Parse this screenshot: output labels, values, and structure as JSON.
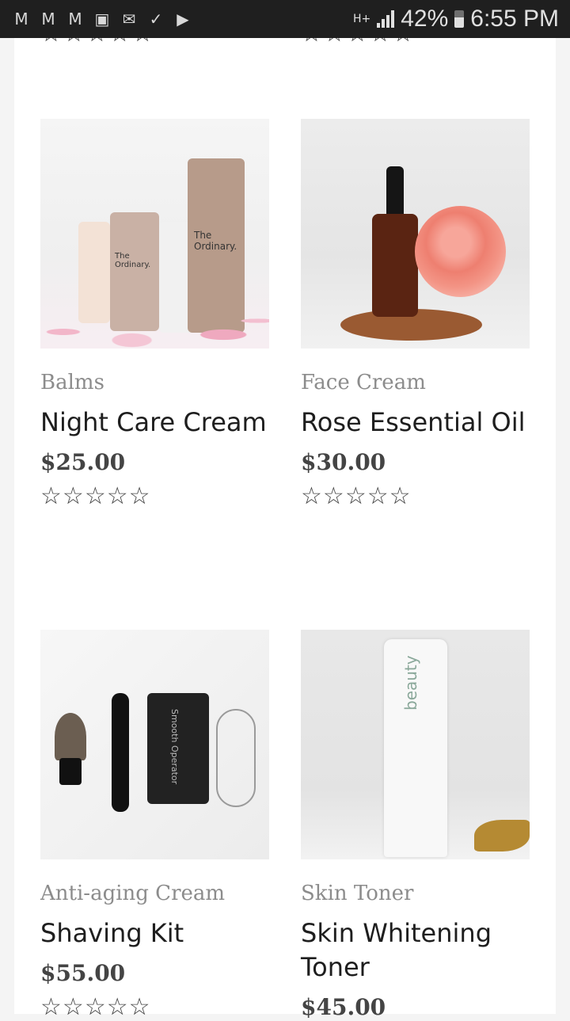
{
  "status": {
    "left_icons": [
      "gmail-icon",
      "gmail-icon",
      "gmail-icon",
      "gallery-icon",
      "mail-icon",
      "check-icon",
      "youtube-icon"
    ],
    "network": "H+",
    "battery": "42%",
    "time": "6:55 PM"
  },
  "top_stars": {
    "rating": 0
  },
  "products": [
    {
      "category": "Balms",
      "title": "Night Care Cream",
      "price": "$25.00",
      "rating": 0
    },
    {
      "category": "Face Cream",
      "title": "Rose Essential Oil",
      "price": "$30.00",
      "rating": 0
    },
    {
      "category": "Anti-aging Cream",
      "title": "Shaving Kit",
      "price": "$55.00",
      "rating": 0
    },
    {
      "category": "Skin Toner",
      "title": "Skin Whitening Toner",
      "price": "$45.00",
      "rating": 0
    }
  ],
  "image_text": {
    "ordinary": "The Ordinary.",
    "operator": "Smooth Operator",
    "beauty": "beauty"
  },
  "icons": {
    "star": "☆"
  }
}
